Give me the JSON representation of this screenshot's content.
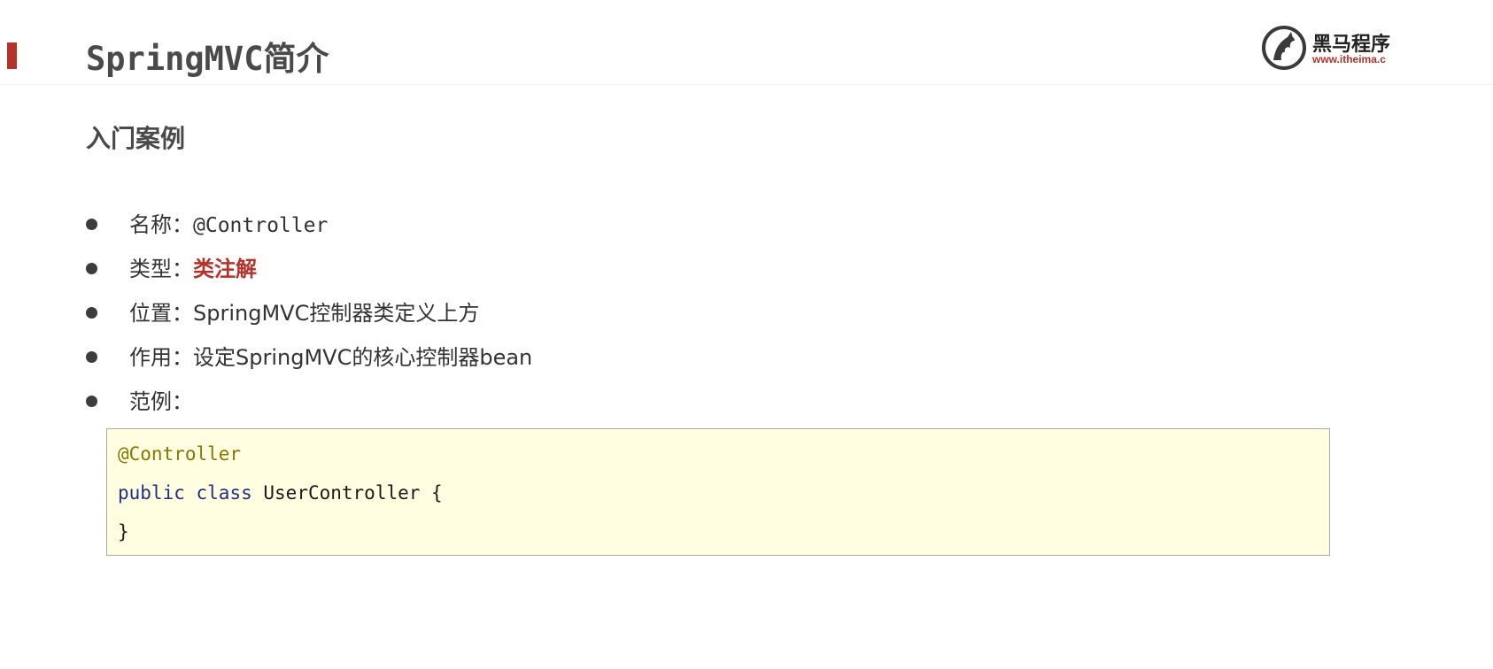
{
  "header": {
    "title": "SpringMVC简介",
    "accent_color": "#b5322a"
  },
  "logo": {
    "name": "黑马程序",
    "url": "www.itheima.c",
    "icon": "horse-head-logo-icon"
  },
  "section": {
    "title": "入门案例"
  },
  "bullets": [
    {
      "label": "名称：",
      "value": "@Controller"
    },
    {
      "label": "类型：",
      "value": "类注解"
    },
    {
      "label": "位置：",
      "value": "SpringMVC控制器类定义上方"
    },
    {
      "label": "作用：",
      "value": "设定SpringMVC的核心控制器bean"
    },
    {
      "label": "范例：",
      "value": ""
    }
  ],
  "code": {
    "line1": "@Controller",
    "line2_kw1": "public",
    "line2_kw2": "class",
    "line2_rest": "UserController {",
    "line3": "}",
    "background": "#fffee0"
  }
}
